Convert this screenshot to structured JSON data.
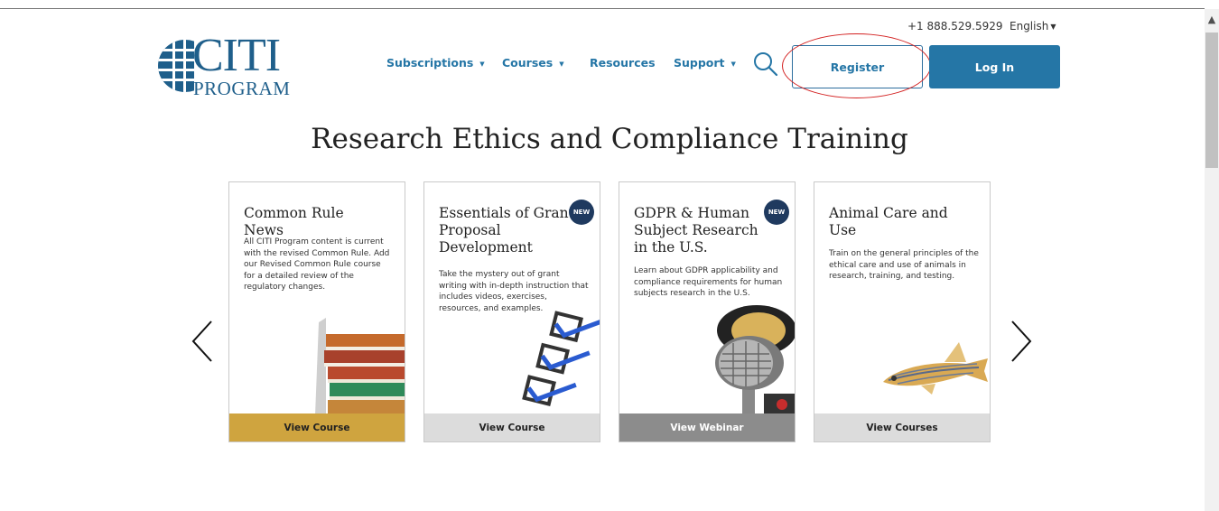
{
  "header": {
    "logo_text": "CITI",
    "logo_subtext": "PROGRAM",
    "phone": "+1 888.529.5929",
    "language": "English"
  },
  "nav": {
    "subscriptions": "Subscriptions",
    "courses": "Courses",
    "resources": "Resources",
    "support": "Support"
  },
  "buttons": {
    "register": "Register",
    "login": "Log In"
  },
  "headline": "Research Ethics and Compliance Training",
  "cards": [
    {
      "title": "Common Rule News",
      "description": "All CITI Program content is current with the revised Common Rule. Add our Revised Common Rule course for a detailed review of the regulatory changes.",
      "badge": "",
      "button": "View Course",
      "button_color": "#cfa43f",
      "image": "books-icon"
    },
    {
      "title": "Essentials of Grant Proposal Development",
      "description": "Take the mystery out of grant writing with in-depth instruction that includes videos, exercises, resources, and examples.",
      "badge": "NEW",
      "button": "View Course",
      "button_color": "#dcdcdc",
      "image": "checkboxes-icon"
    },
    {
      "title": "GDPR & Human Subject Research in the U.S.",
      "description": "Learn about GDPR applicability and compliance requirements for human subjects research in the U.S.",
      "badge": "NEW",
      "button": "View Webinar",
      "button_color": "#8c8c8c",
      "image": "microphone-icon"
    },
    {
      "title": "Animal Care and Use",
      "description": "Train on the general principles of the ethical care and use of animals in research, training, and testing.",
      "badge": "",
      "button": "View Courses",
      "button_color": "#dcdcdc",
      "image": "zebrafish-icon"
    }
  ],
  "colors": {
    "brand_blue": "#2576a6",
    "logo_blue": "#1f5f8b",
    "badge_navy": "#1f3a5f",
    "highlight_red": "#d32020"
  }
}
